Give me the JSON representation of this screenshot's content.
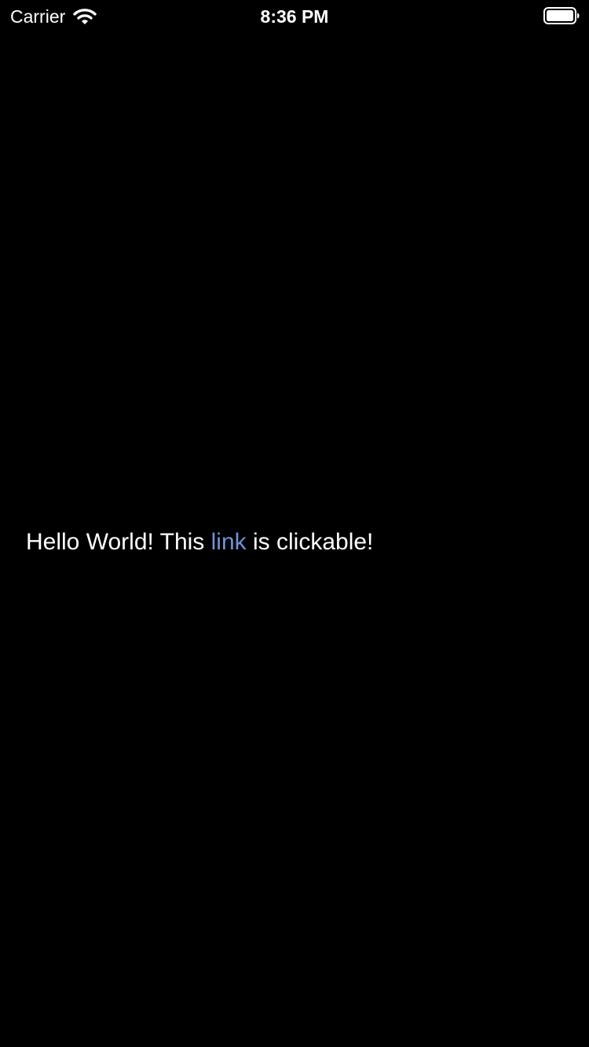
{
  "status_bar": {
    "carrier": "Carrier",
    "time": "8:36 PM",
    "wifi_icon": "wifi-icon",
    "battery_icon": "battery-icon"
  },
  "content": {
    "text_before": "Hello World! This ",
    "link_text": "link",
    "text_after": " is clickable!"
  },
  "colors": {
    "background": "#000000",
    "text": "#ffffff",
    "link": "#6f93d6"
  }
}
